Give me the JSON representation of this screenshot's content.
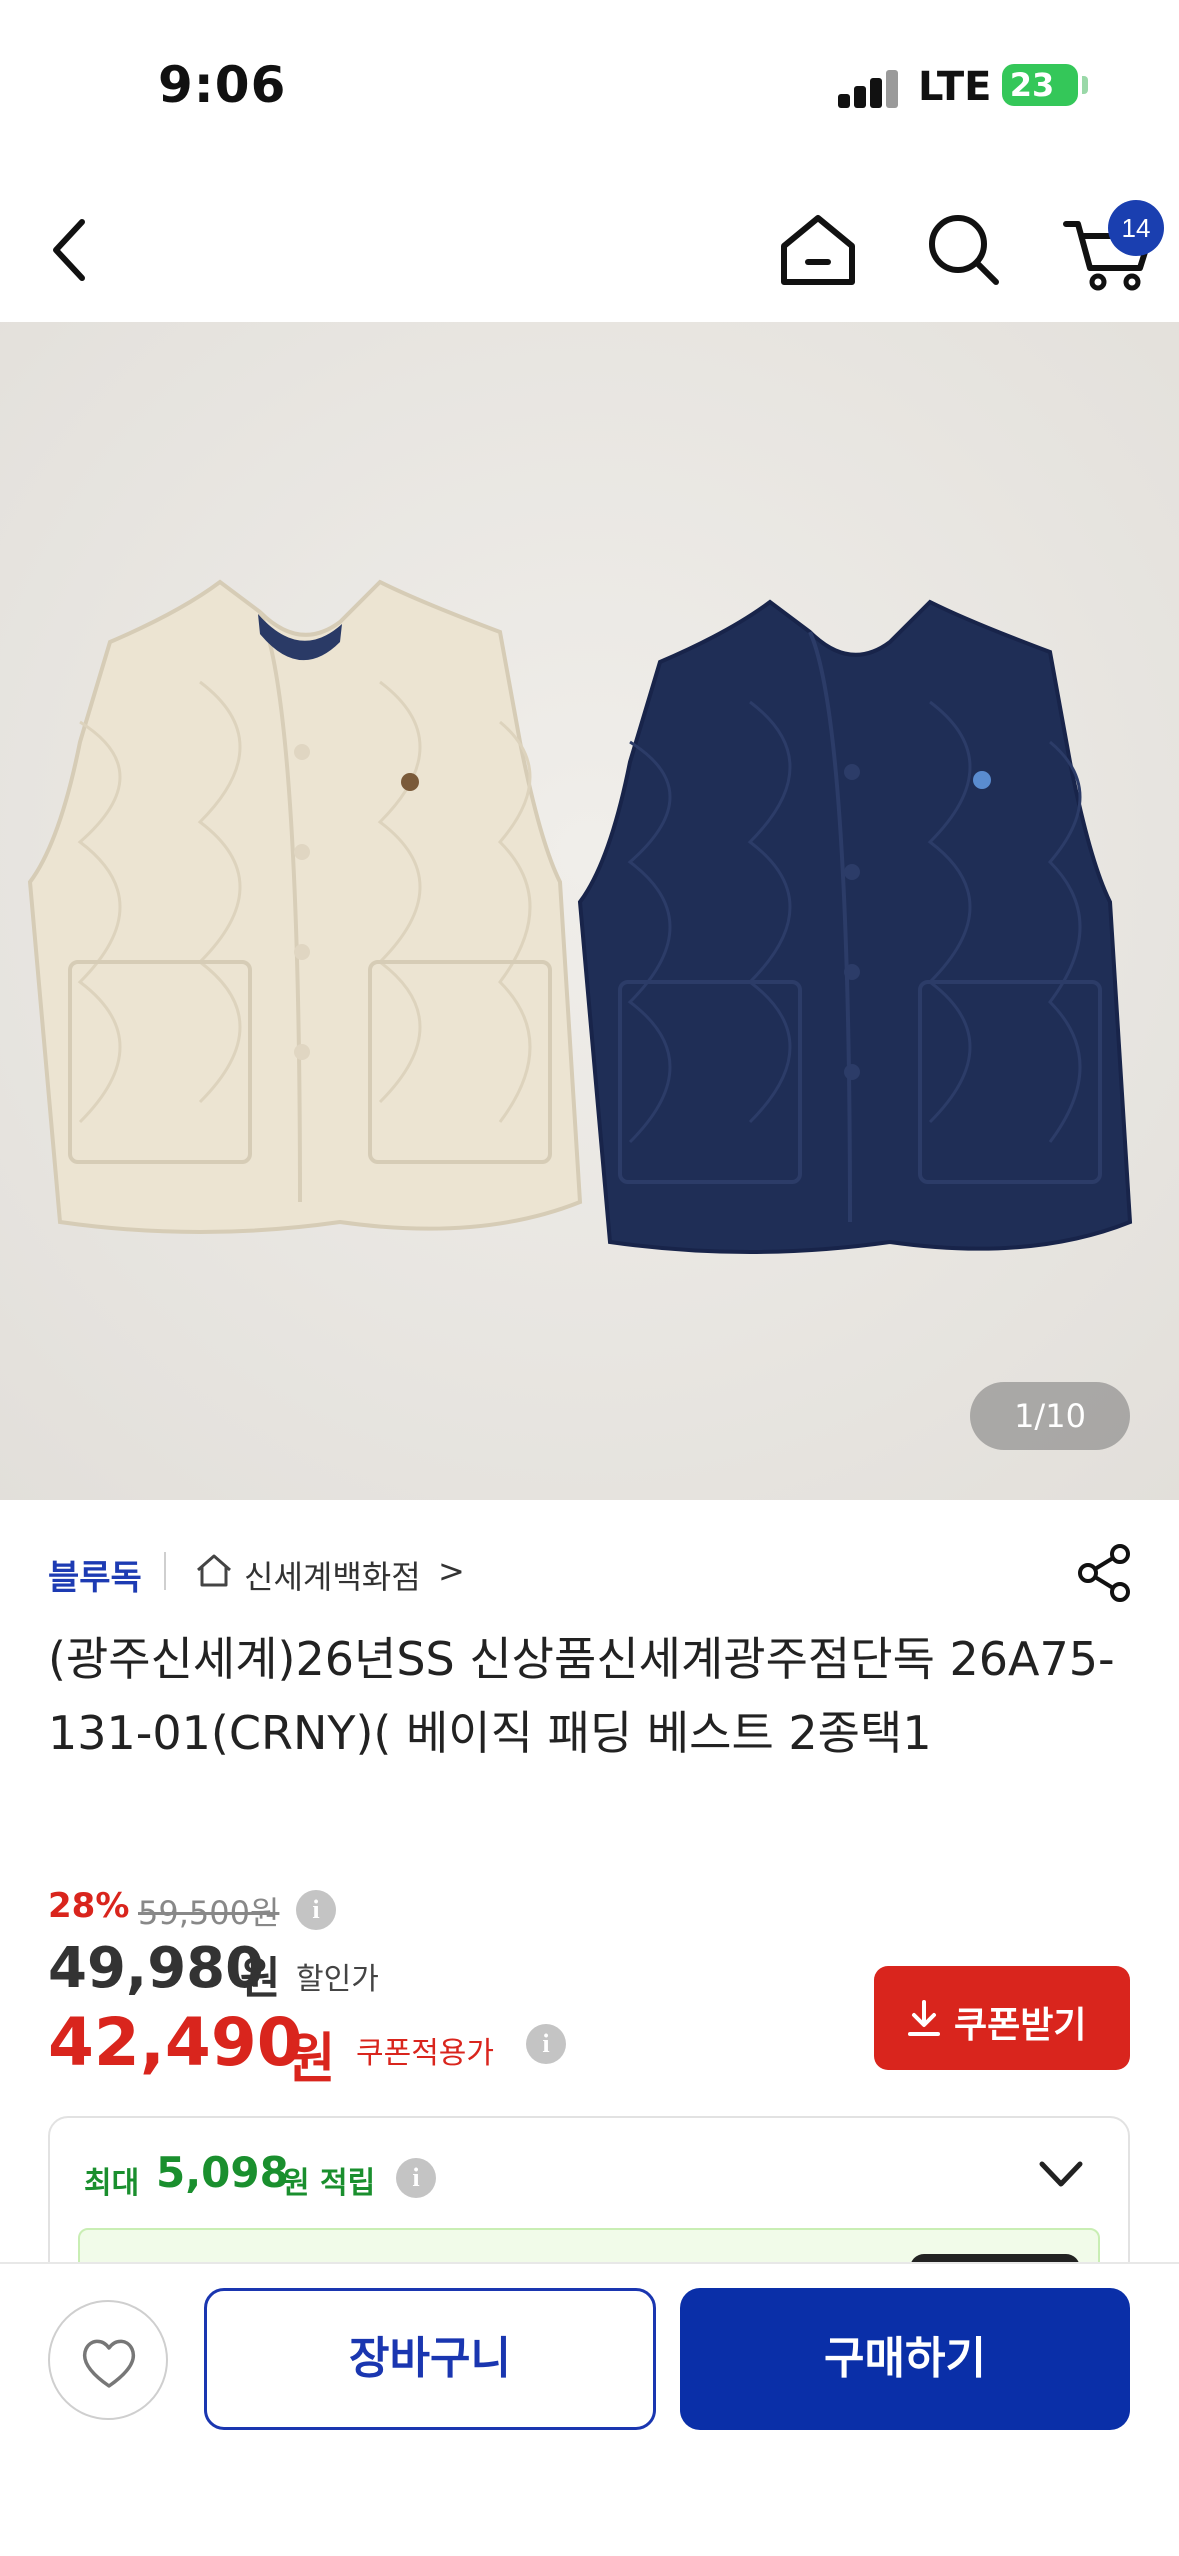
{
  "status_bar": {
    "time": "9:06",
    "network": "LTE",
    "battery": "23"
  },
  "header": {
    "cart_count": "14",
    "icons": [
      "chevron-left-icon",
      "home-icon",
      "search-icon",
      "cart-icon"
    ]
  },
  "product_image": {
    "counter": "1/10"
  },
  "brand": {
    "name": "블루독",
    "store": "신세계백화점",
    "store_chevron": ">"
  },
  "product": {
    "title": "(광주신세계)26년SS 신상품신세계광주점단독 26A75-131-01(CRNY)( 베이직 패딩 베스트 2종택1"
  },
  "price": {
    "discount_rate": "28%",
    "original": "59,500원",
    "sale": "49,980",
    "sale_unit": "원",
    "sale_label": "할인가",
    "coupon": "42,490",
    "coupon_unit": "원",
    "coupon_label": "쿠폰적용가",
    "info_glyph": "i"
  },
  "coupon_button": {
    "label": "쿠폰받기"
  },
  "points": {
    "label": "최대",
    "value": "5,098",
    "unit": "원 적립"
  },
  "bottom_bar": {
    "cart_label": "장바구니",
    "buy_label": "구매하기"
  },
  "colors": {
    "brand_blue": "#1d3bb3",
    "sale_red": "#d9251d",
    "points_green": "#1a8f2e",
    "buy_button": "#0a2fa8"
  }
}
